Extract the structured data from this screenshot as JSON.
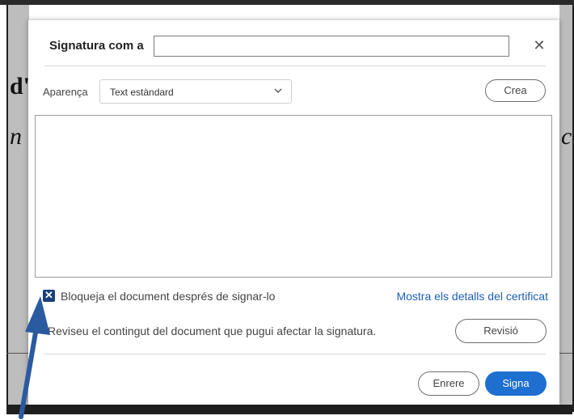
{
  "background": {
    "glyph_d": "d'",
    "glyph_n": "n",
    "glyph_c": "c"
  },
  "dialog": {
    "title_label": "Signatura com a",
    "title_input_value": "",
    "close_icon": "close-icon",
    "appearance": {
      "label": "Aparença",
      "selected": "Text estàndard",
      "chevron_icon": "chevron-down-icon",
      "create_label": "Crea"
    },
    "lock": {
      "checked": true,
      "label": "Bloqueja el document després de signar-lo",
      "certificate_link": "Mostra els detalls del certificat"
    },
    "review": {
      "text": "Reviseu el contingut del document que pugui afectar la signatura.",
      "button_label": "Revisió"
    },
    "footer": {
      "cancel_label": "Enrere",
      "sign_label": "Signa"
    }
  },
  "colors": {
    "accent": "#1f6fd0",
    "link": "#1f5fb8",
    "checkbox": "#1a3f78",
    "annotation_arrow": "#2a5aa0"
  }
}
